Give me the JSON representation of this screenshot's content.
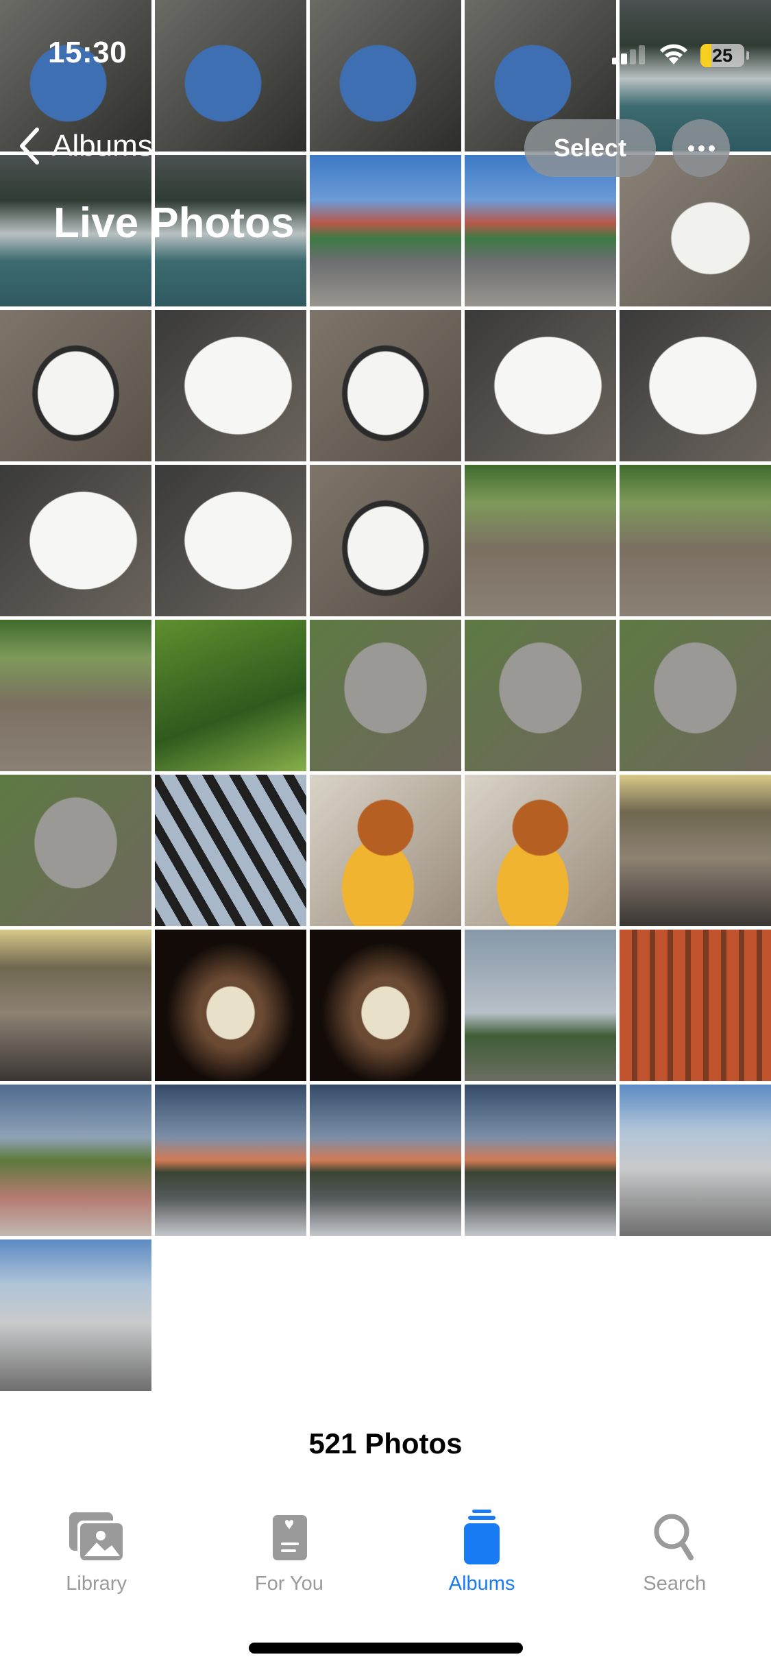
{
  "status_bar": {
    "time": "15:30",
    "signal_bars_active": 2,
    "signal_bars_total": 4,
    "wifi": "wifi-icon",
    "battery_percent": 25,
    "battery_label": "25",
    "battery_color": "#f7cf1f"
  },
  "nav": {
    "back_label": "Albums",
    "title": "Live Photos",
    "select_label": "Select",
    "more_icon": "ellipsis-icon"
  },
  "photos": [
    {
      "subject": "blue bouquet by window",
      "palette": "bouquet"
    },
    {
      "subject": "blue bouquet in car",
      "palette": "bouquet"
    },
    {
      "subject": "blue bouquet on seat",
      "palette": "bouquet"
    },
    {
      "subject": "blue bouquet on seat",
      "palette": "bouquet"
    },
    {
      "subject": "waterfall",
      "palette": "waterfall"
    },
    {
      "subject": "waterfall",
      "palette": "waterfall"
    },
    {
      "subject": "waterfall",
      "palette": "waterfall"
    },
    {
      "subject": "silver car by garages",
      "palette": "car"
    },
    {
      "subject": "silver car by garages",
      "palette": "car"
    },
    {
      "subject": "hand petting cat",
      "palette": "cathand"
    },
    {
      "subject": "black and white cat lying",
      "palette": "catbw"
    },
    {
      "subject": "black and white cat close-up",
      "palette": "catface"
    },
    {
      "subject": "black and white cat",
      "palette": "catbw"
    },
    {
      "subject": "black and white cat",
      "palette": "catface"
    },
    {
      "subject": "black and white cat",
      "palette": "catface"
    },
    {
      "subject": "black and white cat",
      "palette": "catface"
    },
    {
      "subject": "black and white cat",
      "palette": "catface"
    },
    {
      "subject": "black and white cat lying",
      "palette": "catbw"
    },
    {
      "subject": "cat in yard",
      "palette": "catyard"
    },
    {
      "subject": "cat in yard",
      "palette": "catyard"
    },
    {
      "subject": "cat in yard",
      "palette": "catyard"
    },
    {
      "subject": "grass",
      "palette": "grass"
    },
    {
      "subject": "grey cat",
      "palette": "greycat"
    },
    {
      "subject": "hand petting grey cat",
      "palette": "greycat"
    },
    {
      "subject": "hand petting grey cat",
      "palette": "greycat"
    },
    {
      "subject": "hand petting grey cat",
      "palette": "greycat"
    },
    {
      "subject": "pergola roof",
      "palette": "pergola"
    },
    {
      "subject": "burger and fries",
      "palette": "burger"
    },
    {
      "subject": "burger and fries",
      "palette": "burger"
    },
    {
      "subject": "restaurant terrace",
      "palette": "terrace"
    },
    {
      "subject": "restaurant terrace",
      "palette": "terrace"
    },
    {
      "subject": "glowing lamp cube",
      "palette": "lamp"
    },
    {
      "subject": "glowing lamp cube",
      "palette": "lamp"
    },
    {
      "subject": "cloudy sky with tree",
      "palette": "sky"
    },
    {
      "subject": "grilled skewers",
      "palette": "grill"
    },
    {
      "subject": "person on path",
      "palette": "path"
    },
    {
      "subject": "car at sunset",
      "palette": "sunset"
    },
    {
      "subject": "car and person at sunset",
      "palette": "sunset"
    },
    {
      "subject": "car and person at sunset",
      "palette": "sunset"
    },
    {
      "subject": "silver BMW",
      "palette": "bmw"
    },
    {
      "subject": "silver BMW",
      "palette": "bmw"
    }
  ],
  "footer": {
    "count_label": "521 Photos"
  },
  "tabbar": {
    "active_color": "#1a7cf5",
    "inactive_color": "#9a9a9a",
    "tabs": [
      {
        "label": "Library",
        "icon": "library-icon",
        "active": false
      },
      {
        "label": "For You",
        "icon": "for-you-icon",
        "active": false
      },
      {
        "label": "Albums",
        "icon": "albums-icon",
        "active": true
      },
      {
        "label": "Search",
        "icon": "search-icon",
        "active": false
      }
    ]
  }
}
